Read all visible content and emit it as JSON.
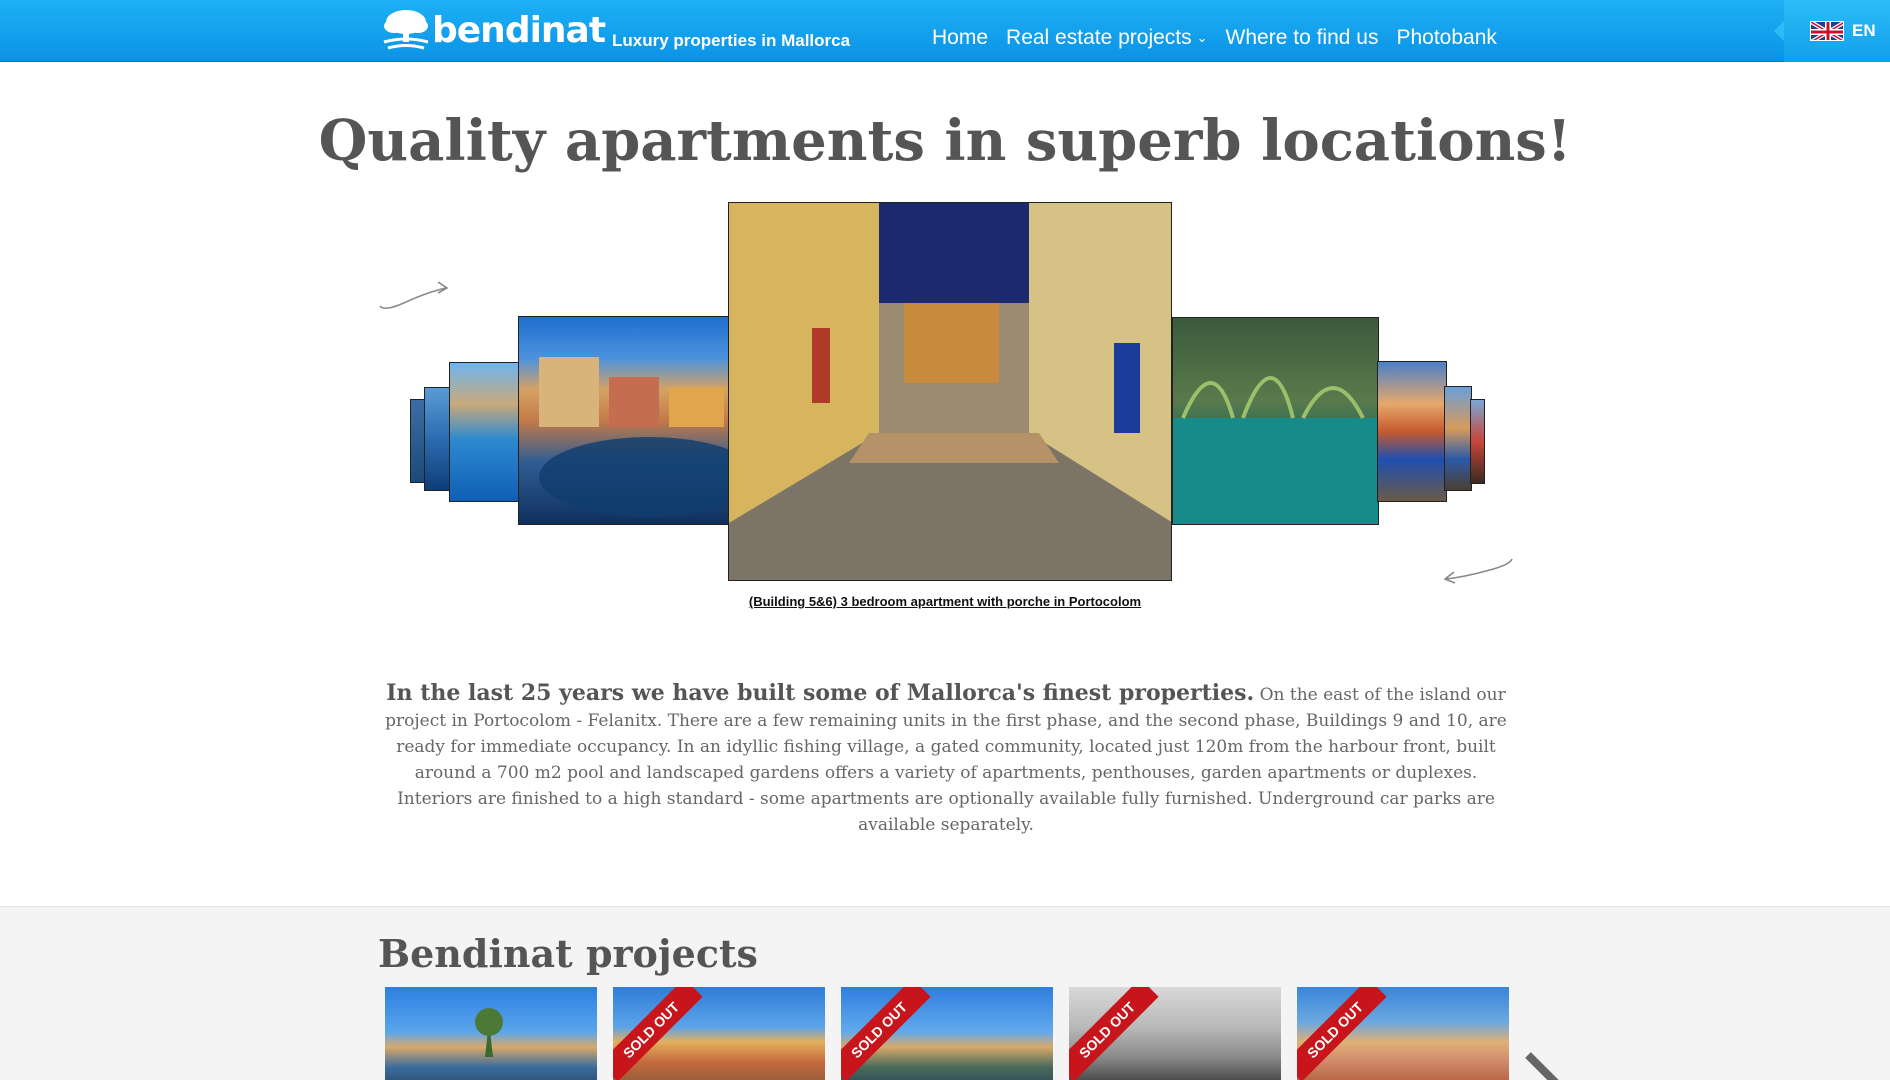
{
  "header": {
    "logo_text": "bendinat",
    "tagline": "Luxury properties in Mallorca",
    "nav": [
      {
        "label": "Home"
      },
      {
        "label": "Real estate projects",
        "has_dropdown": true
      },
      {
        "label": "Where to find us"
      },
      {
        "label": "Photobank"
      }
    ],
    "language": "EN",
    "colors": {
      "header_bg": "#0a93e6",
      "header_accent": "#2cbdf9"
    }
  },
  "hero": {
    "title": "Quality apartments in superb locations!",
    "caption": "(Building 5&6) 3 bedroom apartment with porche in Portocolom"
  },
  "intro": {
    "lead": "In the last 25 years we have built some of Mallorca's finest properties.",
    "body": "On the east of the island our project in Portocolom - Felanitx. There are a few remaining units in the first phase, and the second phase, Buildings 9 and 10, are ready for immediate occupancy. In an idyllic fishing village, a gated community, located just 120m from the harbour front, built around a 700 m2 pool and landscaped gardens offers a variety of apartments, penthouses, garden apartments or duplexes. Interiors are finished to a high standard - some apartments are optionally available fully furnished. Underground car parks are available separately."
  },
  "projects": {
    "title": "Bendinat projects",
    "items": [
      {
        "sold_out": false
      },
      {
        "sold_out": true,
        "ribbon": "SOLD OUT"
      },
      {
        "sold_out": true,
        "ribbon": "SOLD OUT"
      },
      {
        "sold_out": true,
        "ribbon": "SOLD OUT"
      },
      {
        "sold_out": true,
        "ribbon": "SOLD OUT"
      }
    ]
  }
}
